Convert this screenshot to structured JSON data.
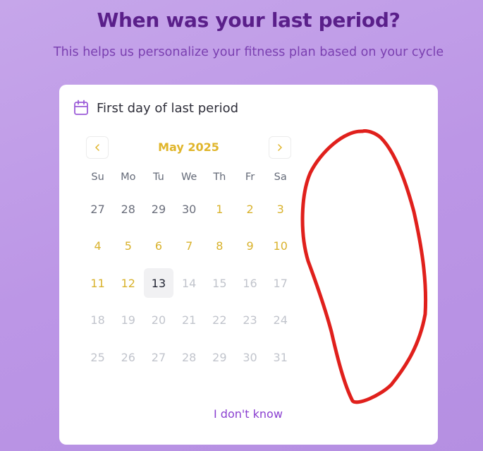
{
  "page": {
    "title": "When was your last period?",
    "subtitle": "This helps us personalize your fitness plan based on your cycle"
  },
  "card": {
    "icon": "calendar-icon",
    "header_label": "First day of last period",
    "calendar": {
      "month_label": "May 2025",
      "prev_icon": "chevron-left-icon",
      "next_icon": "chevron-right-icon",
      "weekdays": [
        "Su",
        "Mo",
        "Tu",
        "We",
        "Th",
        "Fr",
        "Sa"
      ],
      "days": [
        {
          "label": "27",
          "state": "outside"
        },
        {
          "label": "28",
          "state": "outside"
        },
        {
          "label": "29",
          "state": "outside"
        },
        {
          "label": "30",
          "state": "outside"
        },
        {
          "label": "1",
          "state": "available"
        },
        {
          "label": "2",
          "state": "available"
        },
        {
          "label": "3",
          "state": "available"
        },
        {
          "label": "4",
          "state": "available"
        },
        {
          "label": "5",
          "state": "available"
        },
        {
          "label": "6",
          "state": "available"
        },
        {
          "label": "7",
          "state": "available"
        },
        {
          "label": "8",
          "state": "available"
        },
        {
          "label": "9",
          "state": "available"
        },
        {
          "label": "10",
          "state": "available"
        },
        {
          "label": "11",
          "state": "available"
        },
        {
          "label": "12",
          "state": "available"
        },
        {
          "label": "13",
          "state": "today"
        },
        {
          "label": "14",
          "state": "disabled"
        },
        {
          "label": "15",
          "state": "disabled"
        },
        {
          "label": "16",
          "state": "disabled"
        },
        {
          "label": "17",
          "state": "disabled"
        },
        {
          "label": "18",
          "state": "disabled"
        },
        {
          "label": "19",
          "state": "disabled"
        },
        {
          "label": "20",
          "state": "disabled"
        },
        {
          "label": "21",
          "state": "disabled"
        },
        {
          "label": "22",
          "state": "disabled"
        },
        {
          "label": "23",
          "state": "disabled"
        },
        {
          "label": "24",
          "state": "disabled"
        },
        {
          "label": "25",
          "state": "disabled"
        },
        {
          "label": "26",
          "state": "disabled"
        },
        {
          "label": "27",
          "state": "disabled"
        },
        {
          "label": "28",
          "state": "disabled"
        },
        {
          "label": "29",
          "state": "disabled"
        },
        {
          "label": "30",
          "state": "disabled"
        },
        {
          "label": "31",
          "state": "disabled"
        }
      ]
    },
    "dont_know_label": "I don't know"
  },
  "colors": {
    "title": "#5a1f8a",
    "subtitle": "#7a3fb0",
    "accent_yellow": "#e0b52a",
    "link_purple": "#8a3fd0",
    "annotation_red": "#e0201c",
    "icon_purple": "#9b5bd8"
  }
}
